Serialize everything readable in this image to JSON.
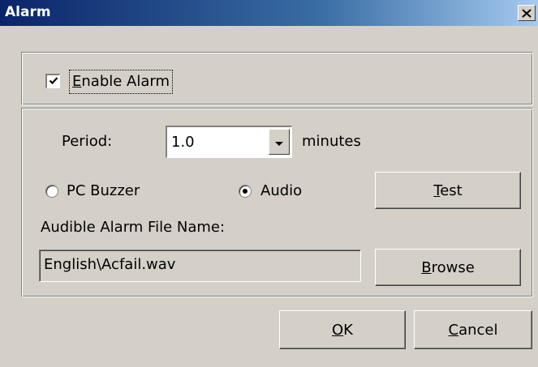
{
  "window": {
    "title": "Alarm",
    "close_icon": "close-icon"
  },
  "enable_alarm": {
    "label": "Enable Alarm",
    "checked": true,
    "accelerator": "E"
  },
  "period": {
    "label": "Period:",
    "value": "1.0",
    "unit": "minutes"
  },
  "sound_source": {
    "options": [
      {
        "label": "PC Buzzer",
        "selected": false
      },
      {
        "label": "Audio",
        "selected": true
      }
    ]
  },
  "test_button": {
    "label": "Test",
    "accelerator": "T"
  },
  "file": {
    "label": "Audible Alarm File Name:",
    "value": "English\\Acfail.wav"
  },
  "browse_button": {
    "label": "Browse",
    "accelerator": "B"
  },
  "ok_button": {
    "label": "OK",
    "accelerator": "O"
  },
  "cancel_button": {
    "label": "Cancel",
    "accelerator": "C"
  },
  "colors": {
    "face": "#d4d0c8",
    "title_start": "#0a246a",
    "title_end": "#a6caf0"
  }
}
